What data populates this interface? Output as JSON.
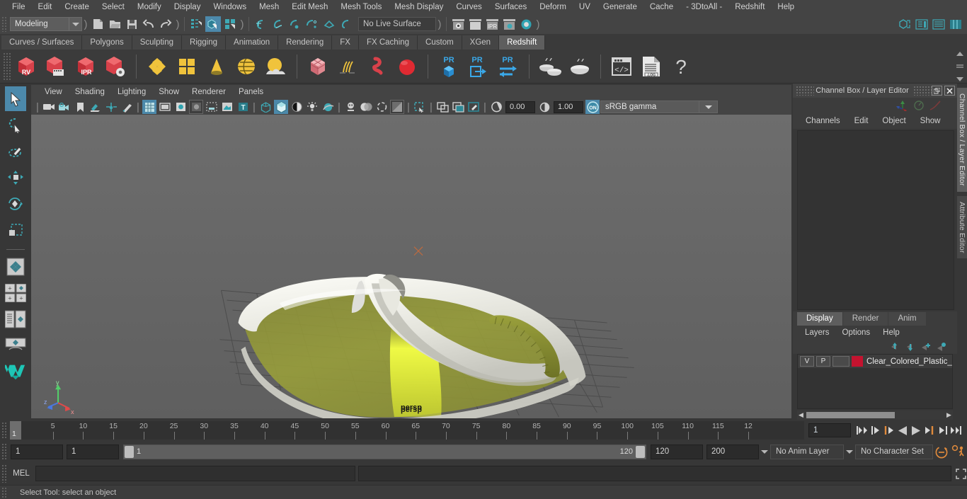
{
  "menubar": {
    "items": [
      "File",
      "Edit",
      "Create",
      "Select",
      "Modify",
      "Display",
      "Windows",
      "Mesh",
      "Edit Mesh",
      "Mesh Tools",
      "Mesh Display",
      "Curves",
      "Surfaces",
      "Deform",
      "UV",
      "Generate",
      "Cache",
      "- 3DtoAll -",
      "Redshift",
      "Help"
    ]
  },
  "statusline": {
    "mode": "Modeling",
    "live_surface": "No Live Surface",
    "icons": [
      "new-scene-icon",
      "open-scene-icon",
      "save-scene-icon",
      "undo-icon",
      "redo-icon",
      "select-by-hierarchy-icon",
      "select-by-object-icon",
      "select-by-component-icon",
      "snap-to-grid-icon",
      "snap-to-curve-icon",
      "snap-to-point-icon",
      "snap-to-projected-center-icon",
      "snap-to-view-plane-icon",
      "make-live-icon",
      "render-view-icon",
      "render-current-frame-icon",
      "ipr-render-icon",
      "render-settings-icon",
      "hypershade-icon"
    ]
  },
  "shelf": {
    "tabs": [
      "Curves / Surfaces",
      "Polygons",
      "Sculpting",
      "Rigging",
      "Animation",
      "Rendering",
      "FX",
      "FX Caching",
      "Custom",
      "XGen",
      "Redshift"
    ],
    "active_tab": "Redshift",
    "buttons": [
      {
        "name": "redshift-render-view-button",
        "label": "RV"
      },
      {
        "name": "redshift-render-sequence-button",
        "label": ""
      },
      {
        "name": "redshift-ipr-button",
        "label": "IPR"
      },
      {
        "name": "redshift-render-settings-button",
        "label": ""
      },
      {
        "name": "redshift-material-button",
        "label": ""
      },
      {
        "name": "redshift-material-blender-button",
        "label": ""
      },
      {
        "name": "redshift-light-cone-button",
        "label": ""
      },
      {
        "name": "redshift-dome-light-button",
        "label": ""
      },
      {
        "name": "redshift-environment-button",
        "label": ""
      },
      {
        "name": "redshift-proxy-button",
        "label": ""
      },
      {
        "name": "redshift-hair-button",
        "label": ""
      },
      {
        "name": "redshift-volume-button",
        "label": ""
      },
      {
        "name": "redshift-sphere-button",
        "label": ""
      },
      {
        "name": "redshift-pr-object-button",
        "label": "PR"
      },
      {
        "name": "redshift-pr-export-button",
        "label": "PR"
      },
      {
        "name": "redshift-pr-transfer-button",
        "label": "PR"
      },
      {
        "name": "redshift-bake-all-button",
        "label": ""
      },
      {
        "name": "redshift-bake-selected-button",
        "label": ""
      },
      {
        "name": "redshift-script-editor-button",
        "label": ""
      },
      {
        "name": "redshift-log-button",
        "label": ".LOG"
      },
      {
        "name": "redshift-help-button",
        "label": "?"
      }
    ]
  },
  "toolbox": {
    "items": [
      {
        "name": "select-tool",
        "selected": true
      },
      {
        "name": "lasso-select-tool",
        "selected": false
      },
      {
        "name": "paint-select-tool",
        "selected": false
      },
      {
        "name": "move-tool",
        "selected": false
      },
      {
        "name": "rotate-tool",
        "selected": false
      },
      {
        "name": "scale-tool",
        "selected": false
      },
      {
        "name": "four-view-layout",
        "selected": false
      },
      {
        "name": "two-pane-layout",
        "selected": false
      },
      {
        "name": "outliner-persp-layout",
        "selected": false
      },
      {
        "name": "single-persp-layout",
        "selected": false
      },
      {
        "name": "maya-logo-icon",
        "selected": false
      }
    ]
  },
  "viewport_panel": {
    "menus": [
      "View",
      "Shading",
      "Lighting",
      "Show",
      "Renderer",
      "Panels"
    ],
    "exposure_value": "0.00",
    "gamma_value": "1.00",
    "color_management": "sRGB gamma",
    "camera_label": "persp",
    "axis_labels": [
      "y",
      "z",
      "x"
    ]
  },
  "channel_box": {
    "title": "Channel Box / Layer Editor",
    "menus": [
      "Channels",
      "Edit",
      "Object",
      "Show"
    ],
    "vertical_tabs": [
      "Channel Box / Layer Editor",
      "Attribute Editor"
    ]
  },
  "layer_editor": {
    "tabs": [
      "Display",
      "Render",
      "Anim"
    ],
    "active_tab": "Display",
    "menus": [
      "Layers",
      "Options",
      "Help"
    ],
    "buttons": [
      "move-layer-up-icon",
      "move-layer-down-icon",
      "new-layer-icon",
      "new-layer-from-selected-icon"
    ],
    "layers": [
      {
        "visibility": "V",
        "playback": "P",
        "third": "",
        "color": "#c4132f",
        "name": "Clear_Colored_Plastic_"
      }
    ]
  },
  "time_slider": {
    "current_frame": "1",
    "frame_field": "1",
    "tick_labels": [
      "5",
      "10",
      "15",
      "20",
      "25",
      "30",
      "35",
      "40",
      "45",
      "50",
      "55",
      "60",
      "65",
      "70",
      "75",
      "80",
      "85",
      "90",
      "95",
      "100",
      "105",
      "110",
      "115",
      "12"
    ],
    "playback_buttons": [
      "go-to-start-icon",
      "step-back-keyframe-icon",
      "step-back-frame-icon",
      "play-backwards-icon",
      "play-forwards-icon",
      "step-forward-frame-icon",
      "step-forward-keyframe-icon",
      "go-to-end-icon"
    ]
  },
  "range_slider": {
    "anim_start": "1",
    "range_start": "1",
    "range_bar_start": "1",
    "range_bar_end": "120",
    "range_end": "120",
    "anim_end": "200",
    "anim_layer": "No Anim Layer",
    "character_set": "No Character Set",
    "icons": [
      "auto-keyframe-icon",
      "animation-preferences-icon"
    ]
  },
  "command_line": {
    "language_label": "MEL",
    "command_value": "",
    "script_editor_icon": "script-editor-icon"
  },
  "help_line": {
    "text": "Select Tool: select an object"
  },
  "colors": {
    "accent_blue": "#4c89ab",
    "teal": "#3ea9b5",
    "window_bg": "#373737",
    "panel_bg": "#444444",
    "viewport_bg": "#666666",
    "orange": "#e08a3c",
    "layer_red": "#c4132f"
  }
}
